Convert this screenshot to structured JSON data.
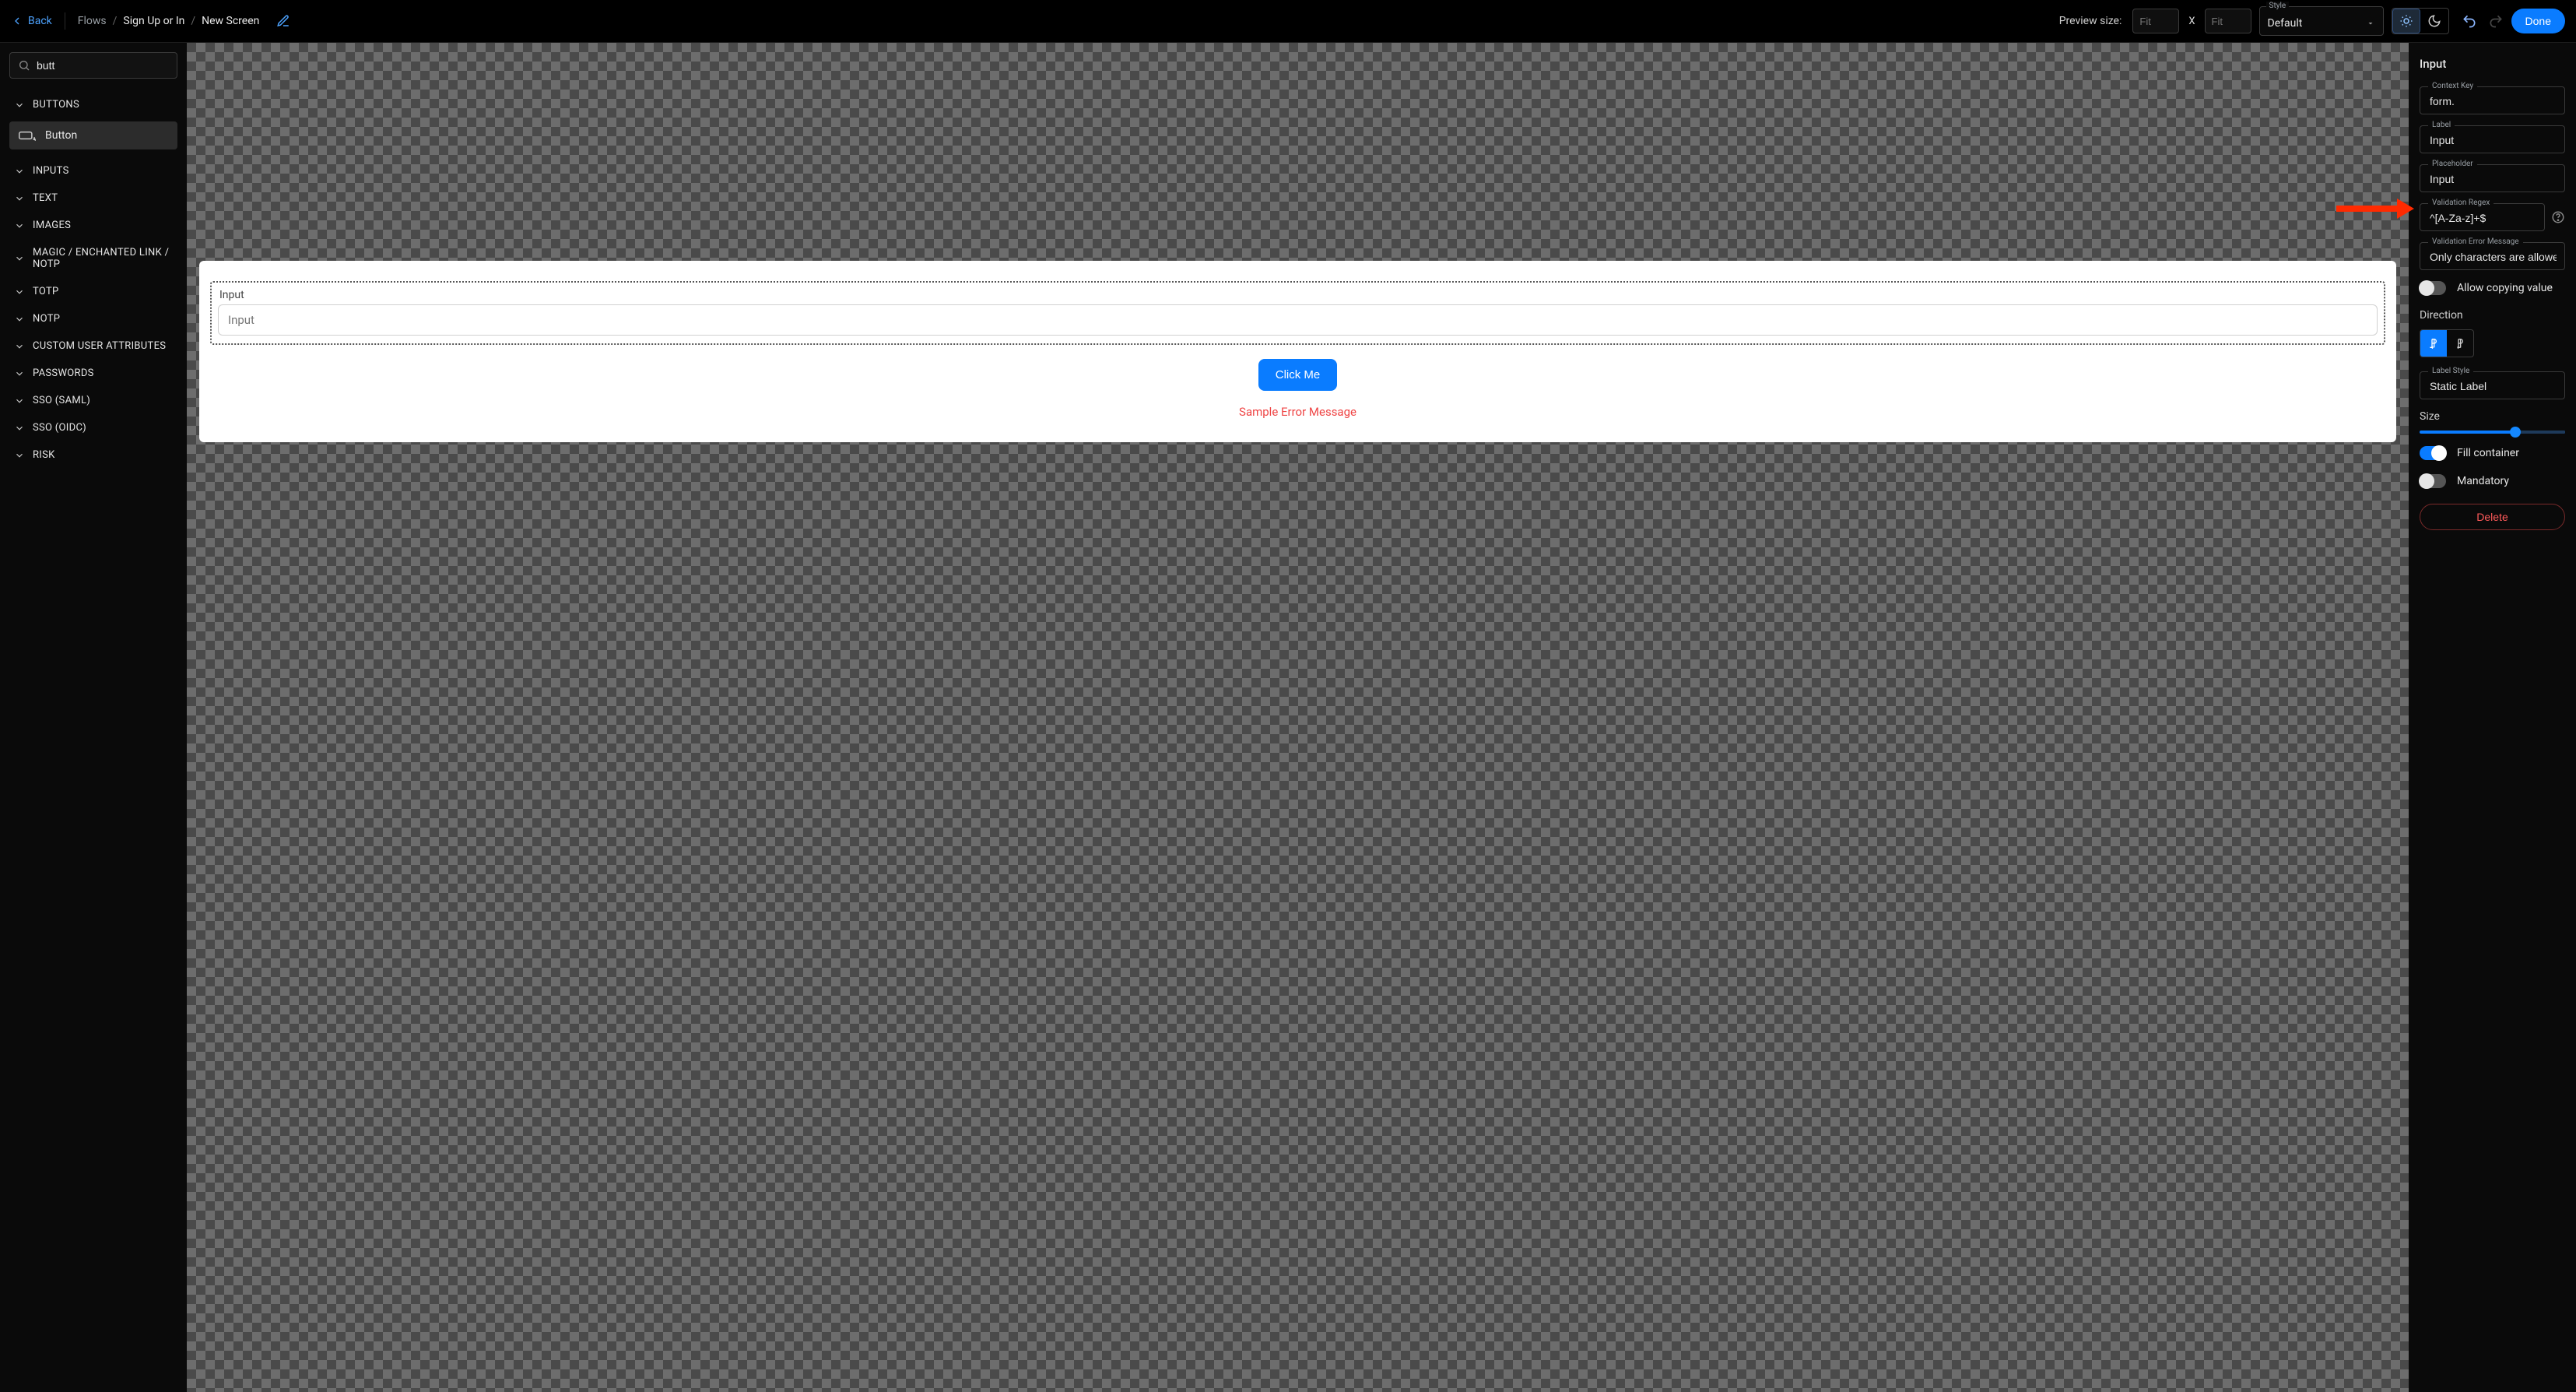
{
  "topbar": {
    "back": "Back",
    "crumbs": {
      "flows": "Flows",
      "flow": "Sign Up or In",
      "screen": "New Screen"
    },
    "preview_label": "Preview size:",
    "fit1": "Fit",
    "fit2": "Fit",
    "x": "X",
    "style_label": "Style",
    "style_value": "Default",
    "done": "Done"
  },
  "sidebar": {
    "search": "butt",
    "categories": [
      "BUTTONS",
      "INPUTS",
      "TEXT",
      "IMAGES",
      "MAGIC / ENCHANTED LINK / NOTP",
      "TOTP",
      "NOTP",
      "CUSTOM USER ATTRIBUTES",
      "PASSWORDS",
      "SSO (SAML)",
      "SSO (OIDC)",
      "RISK"
    ],
    "button_component": "Button"
  },
  "canvas": {
    "input_label": "Input",
    "input_placeholder": "Input",
    "click_me": "Click Me",
    "error_sample": "Sample Error Message"
  },
  "inspector": {
    "title": "Input",
    "context_key_label": "Context Key",
    "context_key_value": "form.",
    "label_label": "Label",
    "label_value": "Input",
    "placeholder_label": "Placeholder",
    "placeholder_value": "Input",
    "regex_label": "Validation Regex",
    "regex_value": "^[A-Za-z]+$",
    "verr_label": "Validation Error Message",
    "verr_value": "Only characters are allowe",
    "allow_copy": "Allow copying value",
    "direction": "Direction",
    "label_style_label": "Label Style",
    "label_style_value": "Static Label",
    "size": "Size",
    "fill": "Fill container",
    "mandatory": "Mandatory",
    "delete": "Delete"
  }
}
